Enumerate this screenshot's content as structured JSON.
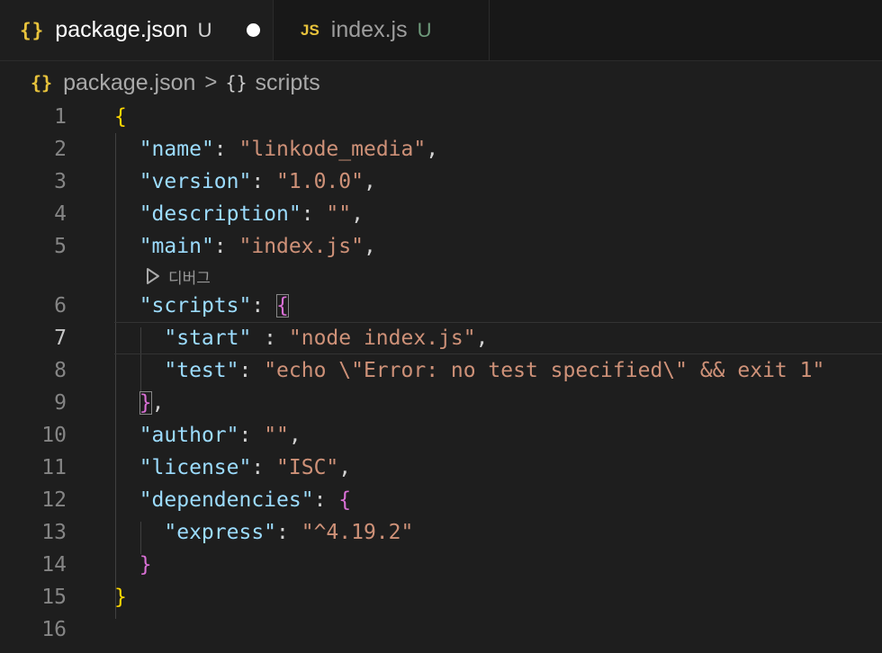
{
  "tabs": [
    {
      "icon": "{}",
      "label": "package.json",
      "status": "U",
      "dirty": true
    },
    {
      "icon": "JS",
      "label": "index.js",
      "status": "U",
      "dirty": false
    }
  ],
  "breadcrumb": {
    "file_icon": "{}",
    "file": "package.json",
    "separator": ">",
    "symbol_icon": "{}",
    "symbol": "scripts"
  },
  "codelens": {
    "label": "디버그"
  },
  "editor": {
    "current_line": 7,
    "line_numbers": [
      "1",
      "2",
      "3",
      "4",
      "5",
      "6",
      "7",
      "8",
      "9",
      "10",
      "11",
      "12",
      "13",
      "14",
      "15",
      "16"
    ],
    "code": {
      "l1_open": "{",
      "l2_key": "\"name\"",
      "l2_value": "\"linkode_media\"",
      "l3_key": "\"version\"",
      "l3_value": "\"1.0.0\"",
      "l4_key": "\"description\"",
      "l4_value": "\"\"",
      "l5_key": "\"main\"",
      "l5_value": "\"index.js\"",
      "l6_key": "\"scripts\"",
      "l6_open": "{",
      "l7_key": "\"start\"",
      "l7_value": "\"node index.js\"",
      "l8_key": "\"test\"",
      "l8_value": "\"echo \\\"Error: no test specified\\\" && exit 1\"",
      "l9_close": "}",
      "l10_key": "\"author\"",
      "l10_value": "\"\"",
      "l11_key": "\"license\"",
      "l11_value": "\"ISC\"",
      "l12_key": "\"dependencies\"",
      "l12_open": "{",
      "l13_key": "\"express\"",
      "l13_value": "\"^4.19.2\"",
      "l14_close": "}",
      "l15_close": "}"
    }
  },
  "colors": {
    "background": "#1e1e1e",
    "key": "#9cdcfe",
    "string": "#ce9178",
    "bracket_level1": "#ffd700",
    "bracket_level2": "#da70d6",
    "json_icon": "#e8c33c"
  }
}
